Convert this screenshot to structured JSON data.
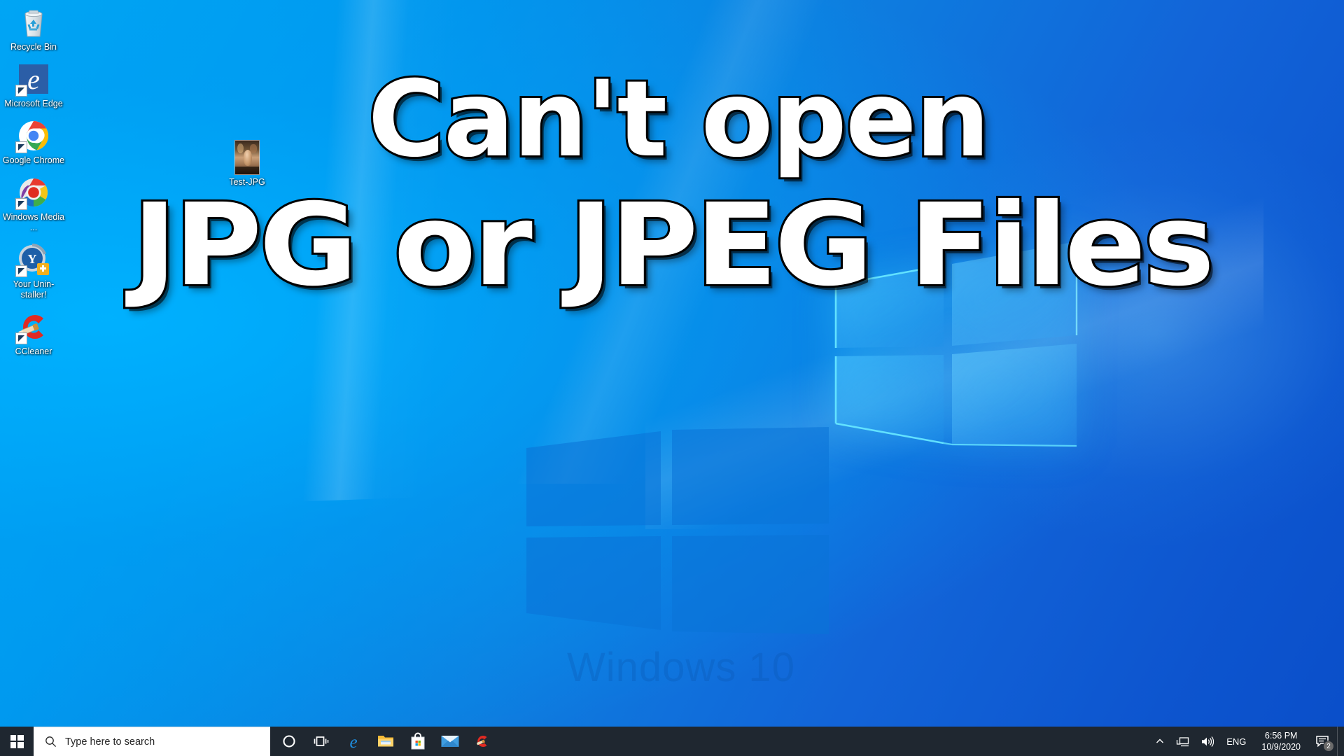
{
  "desktop": {
    "icons": [
      {
        "label": "Recycle Bin",
        "icon": "recycle-bin-icon",
        "shortcut": false
      },
      {
        "label": "Microsoft Edge",
        "icon": "microsoft-edge-icon",
        "shortcut": true
      },
      {
        "label": "Google Chrome",
        "icon": "google-chrome-icon",
        "shortcut": true
      },
      {
        "label": "Windows Media ...",
        "icon": "windows-media-player-icon",
        "shortcut": true
      },
      {
        "label": "Your Unin-staller!",
        "icon": "your-uninstaller-icon",
        "shortcut": true
      },
      {
        "label": "CCleaner",
        "icon": "ccleaner-icon",
        "shortcut": true
      }
    ],
    "file": {
      "label": "Test-JPG",
      "icon": "jpg-thumbnail-icon"
    },
    "wallpaper": {
      "watermark_text": "Windows 10",
      "accent_color": "#0a78e0",
      "background_color": "#00a8f3"
    }
  },
  "overlay": {
    "line1": "Can't open",
    "line2": "JPG or JPEG Files",
    "fill_color": "#ffffff",
    "stroke_color": "#000000"
  },
  "taskbar": {
    "background_color": "#1f2730",
    "start_label": "Start",
    "search": {
      "placeholder": "Type here to search",
      "value": ""
    },
    "apps": [
      {
        "name": "cortana-icon",
        "label": "Cortana"
      },
      {
        "name": "task-view-icon",
        "label": "Task View"
      },
      {
        "name": "microsoft-edge-icon",
        "label": "Microsoft Edge"
      },
      {
        "name": "file-explorer-icon",
        "label": "File Explorer"
      },
      {
        "name": "microsoft-store-icon",
        "label": "Microsoft Store"
      },
      {
        "name": "mail-icon",
        "label": "Mail"
      },
      {
        "name": "ccleaner-icon",
        "label": "CCleaner"
      }
    ],
    "tray": {
      "chevron_label": "Show hidden icons",
      "network_label": "Network",
      "volume_label": "Volume",
      "language": "ENG",
      "time": "6:56 PM",
      "date": "10/9/2020",
      "notification_count": "2"
    }
  }
}
